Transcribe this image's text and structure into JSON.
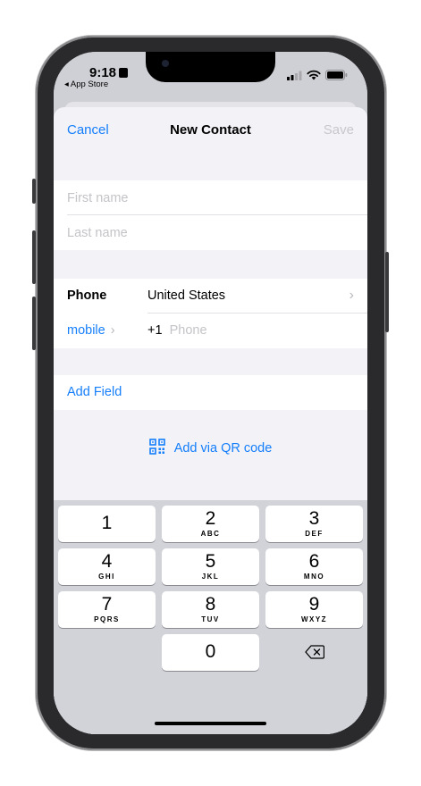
{
  "status_bar": {
    "time": "9:18",
    "back_app": "◂ App Store"
  },
  "navigation": {
    "cancel_label": "Cancel",
    "title": "New Contact",
    "save_label": "Save"
  },
  "name_fields": {
    "first_name_placeholder": "First name",
    "last_name_placeholder": "Last name"
  },
  "phone_section": {
    "label": "Phone",
    "country": "United States",
    "type_label": "mobile",
    "country_code": "+1",
    "phone_placeholder": "Phone"
  },
  "add_field_label": "Add Field",
  "qr_label": "Add via QR code",
  "keypad": {
    "keys": [
      {
        "digit": "1",
        "letters": ""
      },
      {
        "digit": "2",
        "letters": "ABC"
      },
      {
        "digit": "3",
        "letters": "DEF"
      },
      {
        "digit": "4",
        "letters": "GHI"
      },
      {
        "digit": "5",
        "letters": "JKL"
      },
      {
        "digit": "6",
        "letters": "MNO"
      },
      {
        "digit": "7",
        "letters": "PQRS"
      },
      {
        "digit": "8",
        "letters": "TUV"
      },
      {
        "digit": "9",
        "letters": "WXYZ"
      },
      {
        "digit": "0",
        "letters": ""
      }
    ],
    "delete_icon": "delete-backward-icon"
  },
  "colors": {
    "accent": "#147efb",
    "placeholder": "#c4c4c8",
    "disabled": "#c7c7cc",
    "keyboard_bg": "#d1d3d9"
  }
}
